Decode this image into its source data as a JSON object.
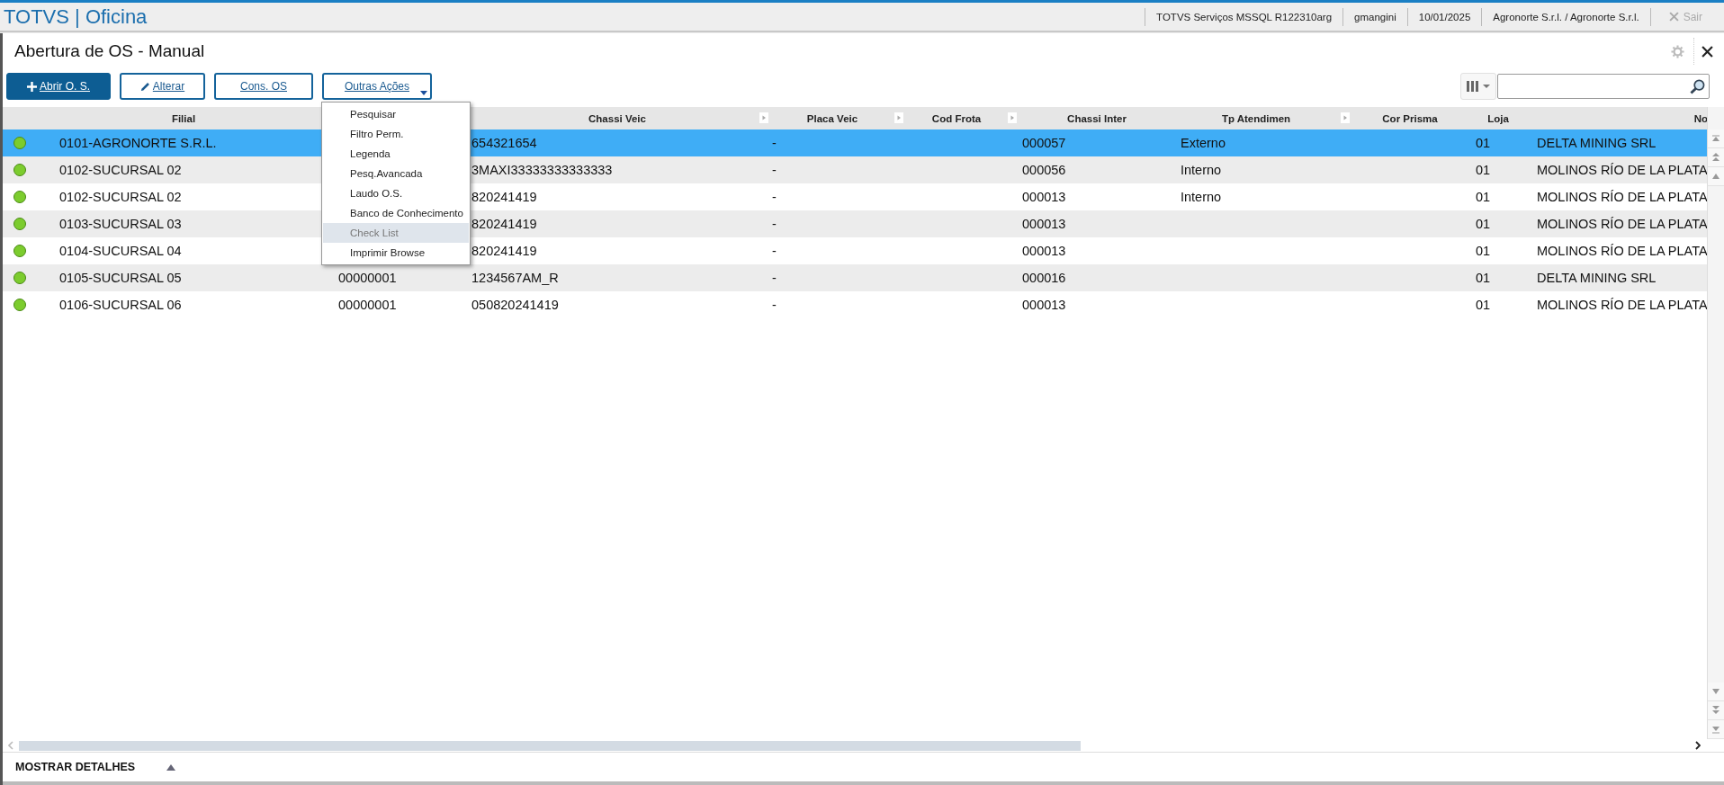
{
  "app": {
    "title": "TOTVS | Oficina",
    "status_items": [
      "TOTVS Serviços MSSQL R122310arg",
      "gmangini",
      "10/01/2025",
      "Agronorte S.r.l. / Agronorte S.r.l."
    ],
    "exit": {
      "label": "Sair",
      "disabled": true
    }
  },
  "page": {
    "title": "Abertura de OS - Manual"
  },
  "toolbar": [
    {
      "label": "Abrir O. S.",
      "kind": "primary",
      "dropdown": false
    },
    {
      "label": "Alterar",
      "kind": "outline",
      "dropdown": false
    },
    {
      "label": "Cons. OS",
      "kind": "outline",
      "dropdown": false
    },
    {
      "label": "Outras Ações",
      "kind": "outline",
      "dropdown": true
    }
  ],
  "menu": [
    {
      "label": "Pesquisar",
      "highlighted": false
    },
    {
      "label": "Filtro Perm.",
      "highlighted": false
    },
    {
      "label": "Legenda",
      "highlighted": false
    },
    {
      "label": "Pesq.Avancada",
      "highlighted": false
    },
    {
      "label": "Laudo O.S.",
      "highlighted": false
    },
    {
      "label": "Banco de Conhecimento",
      "highlighted": false
    },
    {
      "label": "Check List",
      "highlighted": true
    },
    {
      "label": "Imprimir Browse",
      "highlighted": false
    }
  ],
  "table": {
    "columns": [
      {
        "label": "Filial",
        "arrow": false
      },
      {},
      {
        "label": "Chassi Veic",
        "arrow": true
      },
      {
        "label": "Placa Veic",
        "arrow": true
      },
      {
        "label": "Cod Frota",
        "arrow": true
      },
      {
        "label": "Chassi Inter",
        "arrow": false
      },
      {
        "label": "Tp Atendimen",
        "arrow": true
      },
      {
        "label": "Cor Prisma",
        "arrow": false
      },
      {
        "label": "Loja",
        "arrow": false
      },
      {
        "label": "No",
        "arrow": false
      }
    ],
    "rows": [
      {
        "color": "#7ccc2e",
        "selected": true,
        "filial": "0101-AGRONORTE S.R.L.",
        "chassi": "654321654",
        "placa": "-",
        "chassi_inter": "000057",
        "tp": "Externo",
        "loja": "01",
        "nome": "DELTA MINING SRL"
      },
      {
        "color": "#7ccc2e",
        "selected": false,
        "filial": "0102-SUCURSAL 02",
        "chassi": "3MAXI33333333333333",
        "placa": "-",
        "chassi_inter": "000056",
        "tp": "Interno",
        "loja": "01",
        "nome": "MOLINOS RÍO DE LA PLATA"
      },
      {
        "color": "#7ccc2e",
        "selected": false,
        "filial": "0102-SUCURSAL 02",
        "chassi": "820241419",
        "placa": "-",
        "chassi_inter": "000013",
        "tp": "Interno",
        "loja": "01",
        "nome": "MOLINOS RÍO DE LA PLATA"
      },
      {
        "color": "#7ccc2e",
        "selected": false,
        "filial": "0103-SUCURSAL 03",
        "chassi": "820241419",
        "placa": "-",
        "chassi_inter": "000013",
        "loja": "01",
        "nome": "MOLINOS RÍO DE LA PLATA"
      },
      {
        "color": "#7ccc2e",
        "selected": false,
        "filial": "0104-SUCURSAL 04",
        "chassi": "820241419",
        "placa": "-",
        "chassi_inter": "000013",
        "loja": "01",
        "nome": "MOLINOS RÍO DE LA PLATA"
      },
      {
        "color": "#7ccc2e",
        "selected": false,
        "filial": "0105-SUCURSAL 05",
        "column_2": "00000001",
        "chassi": "1234567AM_R",
        "placa": "-",
        "chassi_inter": "000016",
        "loja": "01",
        "nome": "DELTA MINING SRL"
      },
      {
        "color": "#7ccc2e",
        "selected": false,
        "filial": "0106-SUCURSAL 06",
        "column_2": "00000001",
        "chassi": "050820241419",
        "placa": "-",
        "chassi_inter": "000013",
        "loja": "01",
        "nome": "MOLINOS RÍO DE LA PLATA"
      }
    ]
  },
  "footer": {
    "label": "MOSTRAR DETALHES"
  }
}
